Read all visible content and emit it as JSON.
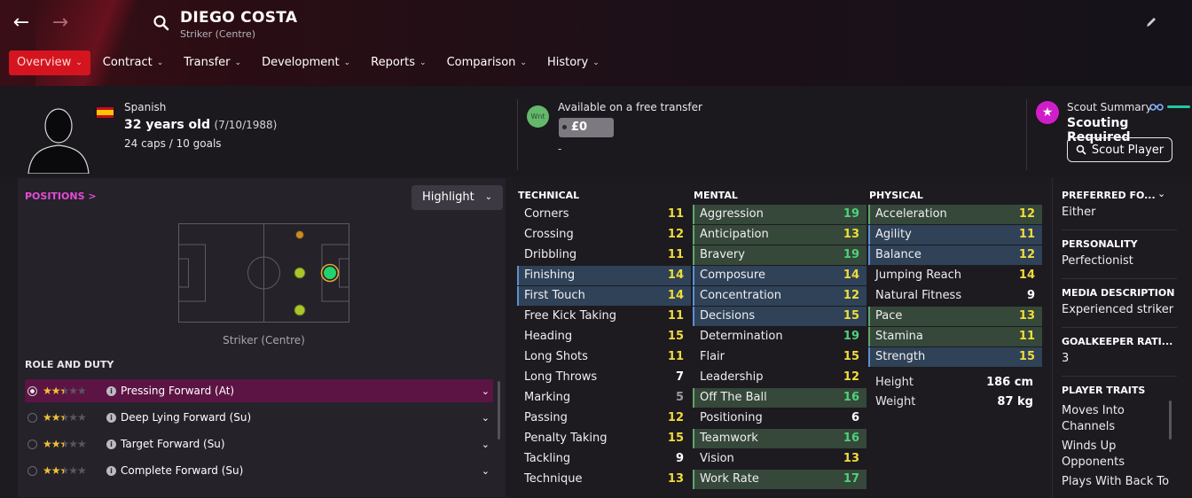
{
  "player": {
    "name": "DIEGO COSTA",
    "position": "Striker (Centre)",
    "nationality": "Spanish",
    "age_text": "32 years old",
    "dob": "(7/10/1988)",
    "caps_goals": "24 caps / 10 goals"
  },
  "tabs": [
    {
      "label": "Overview",
      "active": true
    },
    {
      "label": "Contract"
    },
    {
      "label": "Transfer"
    },
    {
      "label": "Development"
    },
    {
      "label": "Reports"
    },
    {
      "label": "Comparison"
    },
    {
      "label": "History"
    }
  ],
  "transfer": {
    "badge": "Wnt",
    "status": "Available on a free transfer",
    "price": "£0",
    "sub": "-"
  },
  "scout": {
    "summary_label": "Scout Summary",
    "status": "Scouting Required",
    "button": "Scout Player"
  },
  "positions": {
    "label": "POSITIONS >",
    "highlight_label": "Highlight",
    "caption": "Striker (Centre)"
  },
  "roles": {
    "title": "ROLE AND DUTY",
    "items": [
      {
        "label": "Pressing Forward (At)",
        "stars_filled": 2.5,
        "selected": true
      },
      {
        "label": "Deep Lying Forward (Su)",
        "stars_filled": 2.5
      },
      {
        "label": "Target Forward (Su)",
        "stars_filled": 2.5
      },
      {
        "label": "Complete Forward (Su)",
        "stars_filled": 2.5
      }
    ]
  },
  "attributes": {
    "technical_title": "TECHNICAL",
    "mental_title": "MENTAL",
    "physical_title": "PHYSICAL",
    "technical": [
      {
        "name": "Corners",
        "value": "11"
      },
      {
        "name": "Crossing",
        "value": "12"
      },
      {
        "name": "Dribbling",
        "value": "11"
      },
      {
        "name": "Finishing",
        "value": "14",
        "hl": "blue"
      },
      {
        "name": "First Touch",
        "value": "14",
        "hl": "blue"
      },
      {
        "name": "Free Kick Taking",
        "value": "11"
      },
      {
        "name": "Heading",
        "value": "15"
      },
      {
        "name": "Long Shots",
        "value": "11"
      },
      {
        "name": "Long Throws",
        "value": "7"
      },
      {
        "name": "Marking",
        "value": "5"
      },
      {
        "name": "Passing",
        "value": "12"
      },
      {
        "name": "Penalty Taking",
        "value": "15"
      },
      {
        "name": "Tackling",
        "value": "9"
      },
      {
        "name": "Technique",
        "value": "13"
      }
    ],
    "mental": [
      {
        "name": "Aggression",
        "value": "19",
        "hl": "green"
      },
      {
        "name": "Anticipation",
        "value": "13",
        "hl": "green"
      },
      {
        "name": "Bravery",
        "value": "19",
        "hl": "green"
      },
      {
        "name": "Composure",
        "value": "14",
        "hl": "blue"
      },
      {
        "name": "Concentration",
        "value": "12",
        "hl": "blue"
      },
      {
        "name": "Decisions",
        "value": "15",
        "hl": "blue"
      },
      {
        "name": "Determination",
        "value": "19"
      },
      {
        "name": "Flair",
        "value": "15"
      },
      {
        "name": "Leadership",
        "value": "12"
      },
      {
        "name": "Off The Ball",
        "value": "16",
        "hl": "green"
      },
      {
        "name": "Positioning",
        "value": "6"
      },
      {
        "name": "Teamwork",
        "value": "16",
        "hl": "green"
      },
      {
        "name": "Vision",
        "value": "13"
      },
      {
        "name": "Work Rate",
        "value": "17",
        "hl": "green"
      }
    ],
    "physical": [
      {
        "name": "Acceleration",
        "value": "12",
        "hl": "green"
      },
      {
        "name": "Agility",
        "value": "11",
        "hl": "blue"
      },
      {
        "name": "Balance",
        "value": "12",
        "hl": "blue"
      },
      {
        "name": "Jumping Reach",
        "value": "14"
      },
      {
        "name": "Natural Fitness",
        "value": "9"
      },
      {
        "name": "Pace",
        "value": "13",
        "hl": "green"
      },
      {
        "name": "Stamina",
        "value": "11",
        "hl": "green"
      },
      {
        "name": "Strength",
        "value": "15",
        "hl": "blue"
      }
    ],
    "height_label": "Height",
    "height": "186 cm",
    "weight_label": "Weight",
    "weight": "87 kg"
  },
  "side": {
    "pref_foot_label": "PREFERRED FO...",
    "pref_foot": "Either",
    "personality_label": "PERSONALITY",
    "personality": "Perfectionist",
    "media_label": "MEDIA DESCRIPTION",
    "media": "Experienced striker",
    "gk_label": "GOALKEEPER RATI...",
    "gk": "3",
    "traits_label": "PLAYER TRAITS",
    "traits": [
      "Moves Into Channels",
      "Winds Up Opponents",
      "Plays With Back To"
    ]
  },
  "colors": {
    "accent_red": "#d4151f",
    "magenta": "#cf1ec8",
    "value_yellow": "#f0dc3b",
    "value_green": "#4ed27a"
  }
}
